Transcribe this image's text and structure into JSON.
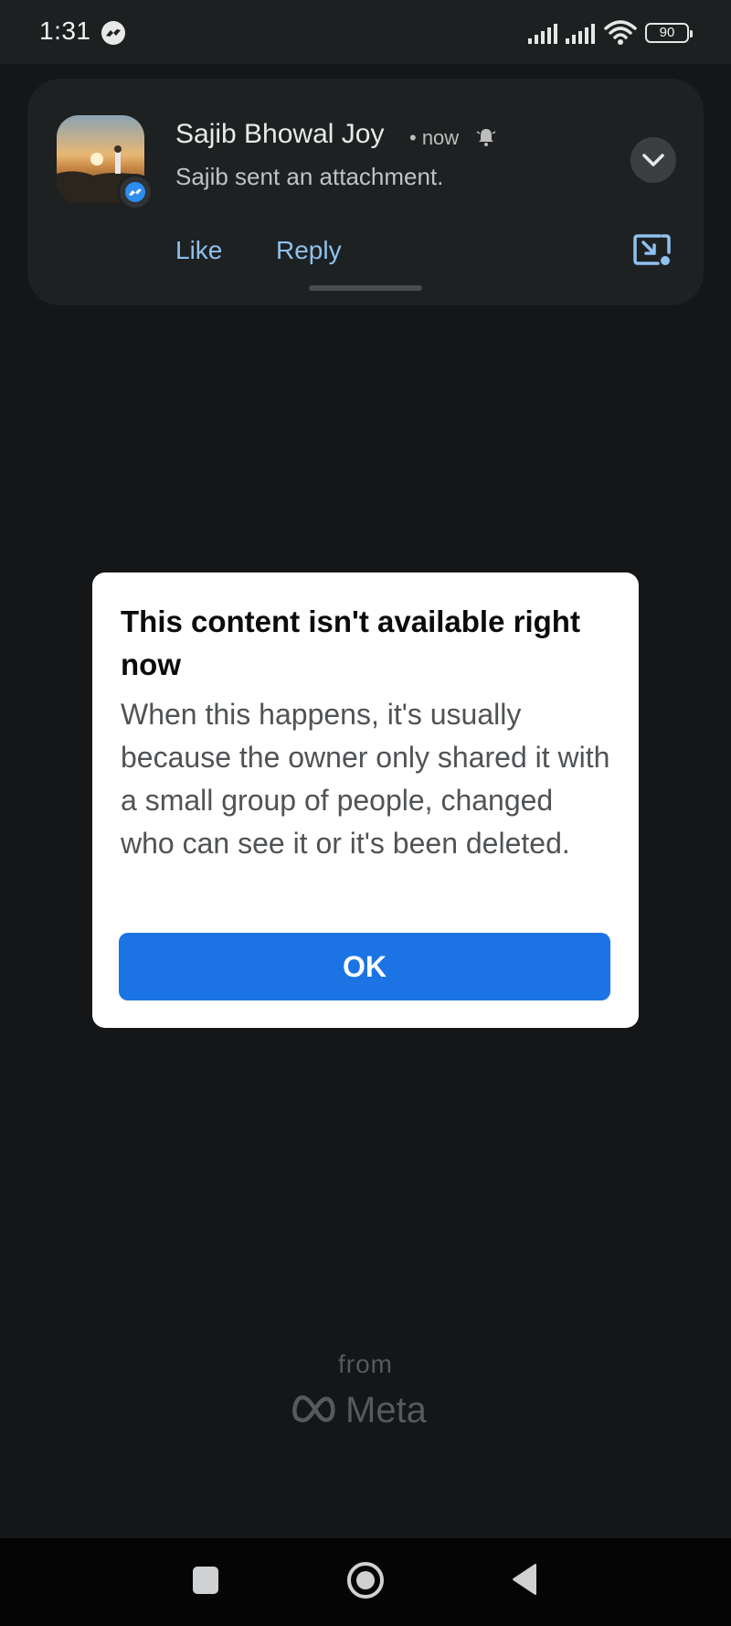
{
  "status_bar": {
    "time": "1:31",
    "battery": "90",
    "icons": [
      "messenger-icon",
      "signal-icon",
      "signal-icon",
      "wifi-icon",
      "battery-icon"
    ]
  },
  "notification": {
    "sender": "Sajib Bhowal Joy",
    "meta": "• now",
    "message": "Sajib sent an attachment.",
    "actions": {
      "like": "Like",
      "reply": "Reply"
    },
    "icons": [
      "bell-icon",
      "chevron-down-icon",
      "picture-in-picture-icon",
      "messenger-badge-icon"
    ]
  },
  "dialog": {
    "title": "This content isn't available right now",
    "body": "When this happens, it's usually because the owner only shared it with a small group of people, changed who can see it or it's been deleted.",
    "ok_label": "OK"
  },
  "footer": {
    "from": "from",
    "brand": "Meta"
  },
  "nav": {
    "icons": [
      "recents-icon",
      "home-icon",
      "back-icon"
    ]
  },
  "colors": {
    "background": "#141617",
    "accent": "#1c74e4",
    "link": "#8ec1ee",
    "card": "#1e2122"
  }
}
